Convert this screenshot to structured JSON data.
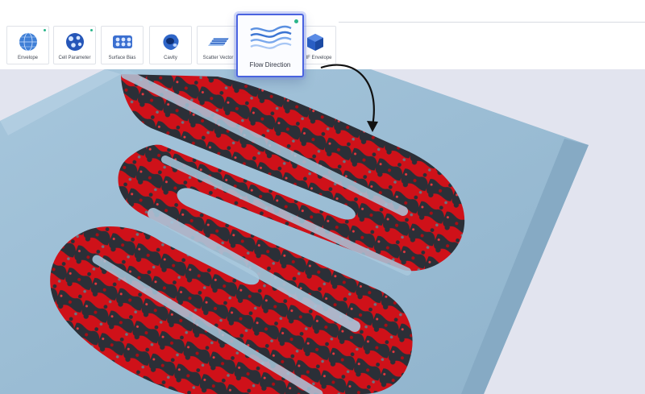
{
  "toolbar": {
    "tools": [
      {
        "label": "Envelope",
        "icon": "globe-mesh-icon",
        "badge": true
      },
      {
        "label": "Cell Parameter",
        "icon": "cell-lattice-icon",
        "badge": true
      },
      {
        "label": "Surface Bias",
        "icon": "surface-bias-icon",
        "badge": false
      },
      {
        "label": "Cavity",
        "icon": "cavity-icon",
        "badge": false
      },
      {
        "label": "Scatter Vector",
        "icon": "scatter-vector-icon",
        "badge": false
      },
      {
        "label": "Flow Direction",
        "icon": "flow-waves-icon",
        "badge": true,
        "active": true
      },
      {
        "label": "IF Envelope",
        "icon": "cube-icon",
        "badge": false
      }
    ]
  },
  "colors": {
    "accent": "#4a63e0",
    "badge": "#2bb58a",
    "lattice_red": "#d0121b",
    "lattice_dark": "#2c3038",
    "plate": "#9dbfd6"
  }
}
